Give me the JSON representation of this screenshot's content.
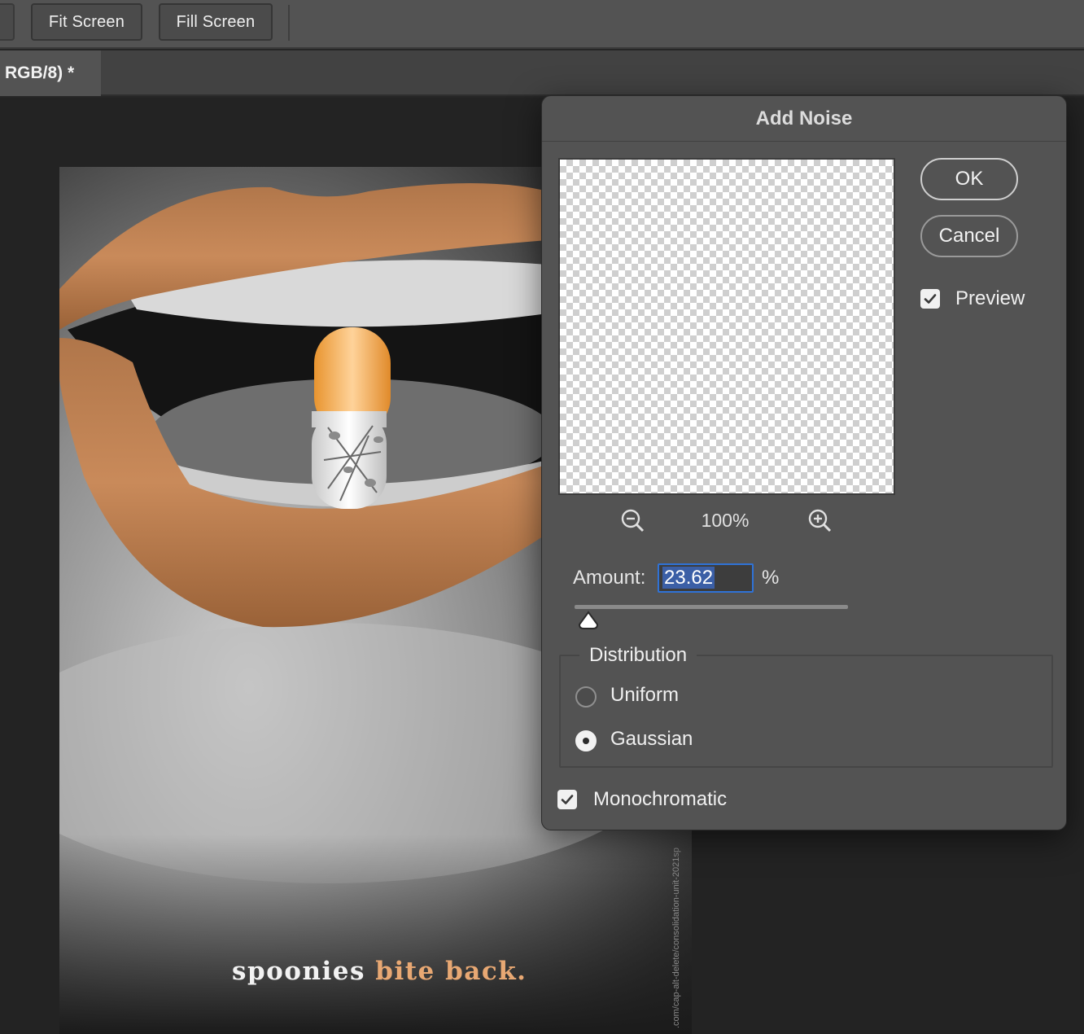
{
  "options_bar": {
    "fit_screen_label": "Fit Screen",
    "fill_screen_label": "Fill Screen"
  },
  "document_tab": {
    "title": "RGB/8) *"
  },
  "canvas": {
    "poster_text_white": "spoonies",
    "poster_text_accent": "bite back.",
    "side_url": ".com/cap-alt-delete/consolidation-unit-2021sp",
    "accent_color": "#e8a873"
  },
  "dialog": {
    "title": "Add Noise",
    "ok_label": "OK",
    "cancel_label": "Cancel",
    "preview_label": "Preview",
    "preview_checked": true,
    "zoom_level": "100%",
    "zoom_out_icon": "zoom-out-icon",
    "zoom_in_icon": "zoom-in-icon",
    "amount_label": "Amount:",
    "amount_value": "23.62",
    "amount_unit": "%",
    "amount_slider_fraction": 0.05,
    "distribution_title": "Distribution",
    "distribution_options": [
      "Uniform",
      "Gaussian"
    ],
    "distribution_selected": "Gaussian",
    "monochromatic_label": "Monochromatic",
    "monochromatic_checked": true
  }
}
